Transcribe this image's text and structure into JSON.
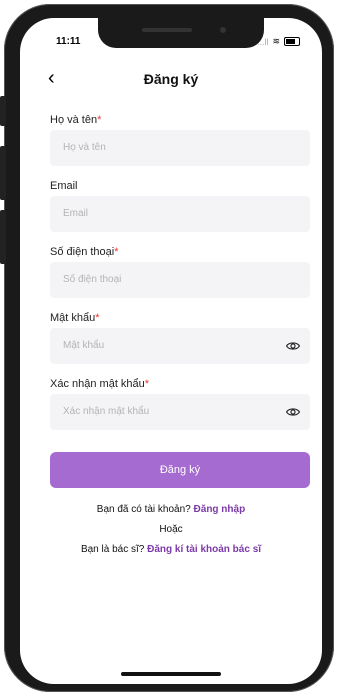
{
  "status_bar": {
    "time": "11:11",
    "signal": "...ll",
    "wifi": "≋"
  },
  "header": {
    "back": "‹",
    "title": "Đăng ký"
  },
  "form": {
    "fullname": {
      "label": "Họ và tên",
      "required": "*",
      "placeholder": "Họ và tên"
    },
    "email": {
      "label": "Email",
      "placeholder": "Email"
    },
    "phone": {
      "label": "Số điện thoại",
      "required": "*",
      "placeholder": "Số điện thoại"
    },
    "password": {
      "label": "Mật khẩu",
      "required": "*",
      "placeholder": "Mật khẩu"
    },
    "confirm": {
      "label": "Xác nhận mật khẩu",
      "required": "*",
      "placeholder": "Xác nhận mật khẩu"
    }
  },
  "submit_label": "Đăng ký",
  "footer": {
    "login_prompt": "Bạn đã có tài khoản?",
    "login_link": "Đăng nhập",
    "or": "Hoặc",
    "doctor_prompt": "Bạn là bác sĩ?",
    "doctor_link": "Đăng kí tài khoản bác sĩ"
  },
  "colors": {
    "accent": "#a56bd0",
    "link": "#7b3aa8",
    "required": "#e53935",
    "field_bg": "#f4f4f6"
  }
}
